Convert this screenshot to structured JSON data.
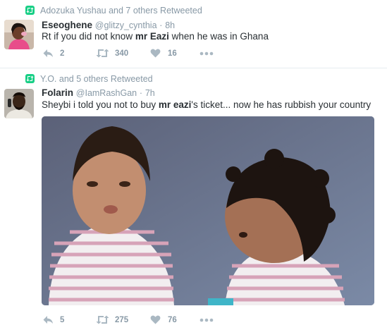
{
  "tweets": [
    {
      "retweet_context": "Adozuka Yushau and 7 others Retweeted",
      "name": "Eseoghene",
      "handle": "@glitzy_cynthia",
      "separator": "·",
      "time": "8h",
      "text_before": "Rt if you did not know ",
      "text_bold": "mr Eazi",
      "text_after": " when he was in Ghana",
      "replies": "2",
      "retweets": "340",
      "likes": "16",
      "icons": [
        "retweet-icon",
        "reply-icon",
        "retweet-icon",
        "heart-icon",
        "more-icon"
      ]
    },
    {
      "retweet_context": "Y.O. and 5 others Retweeted",
      "name": "Folarin",
      "handle": "@IamRashGan",
      "separator": "·",
      "time": "7h",
      "text_before": "Sheybi  i told you not to buy ",
      "text_bold": "mr eazi",
      "text_after": "'s ticket... now he has rubbish your country",
      "replies": "5",
      "retweets": "275",
      "likes": "76",
      "icons": [
        "retweet-icon",
        "reply-icon",
        "retweet-icon",
        "heart-icon",
        "more-icon"
      ]
    }
  ],
  "colors": {
    "retweet_green": "#19cf86",
    "muted_gray": "#8899a6",
    "text_dark": "#292f33",
    "divider": "#e6ecf0"
  }
}
